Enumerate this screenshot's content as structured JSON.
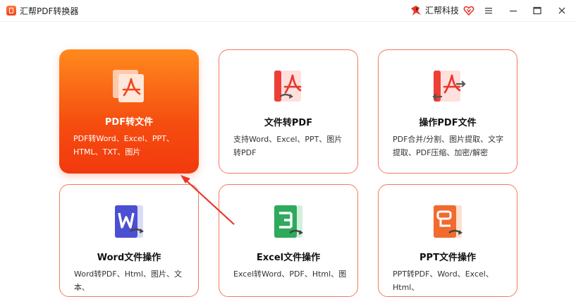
{
  "titlebar": {
    "app_title": "汇帮PDF转换器",
    "brand_label": "汇帮科技"
  },
  "colors": {
    "accent": "#f2390e",
    "card_border": "#f47a5e",
    "annotation_arrow": "#e8362a"
  },
  "cards": [
    {
      "title": "PDF转文件",
      "desc": "PDF转Word、Excel、PPT、HTML、TXT、图片",
      "icon": "pdf-file-icon",
      "selected": true
    },
    {
      "title": "文件转PDF",
      "desc": "支持Word、Excel、PPT、图片转PDF",
      "icon": "file-to-pdf-icon",
      "selected": false
    },
    {
      "title": "操作PDF文件",
      "desc": "PDF合并/分割、图片提取、文字提取、PDF压缩、加密/解密",
      "icon": "pdf-operations-icon",
      "selected": false
    },
    {
      "title": "Word文件操作",
      "desc": "Word转PDF、Html、图片、文本、",
      "icon": "word-file-icon",
      "selected": false
    },
    {
      "title": "Excel文件操作",
      "desc": "Excel转Word、PDF、Html、图",
      "icon": "excel-file-icon",
      "selected": false
    },
    {
      "title": "PPT文件操作",
      "desc": "PPT转PDF、Word、Excel、Html、",
      "icon": "ppt-file-icon",
      "selected": false
    }
  ]
}
